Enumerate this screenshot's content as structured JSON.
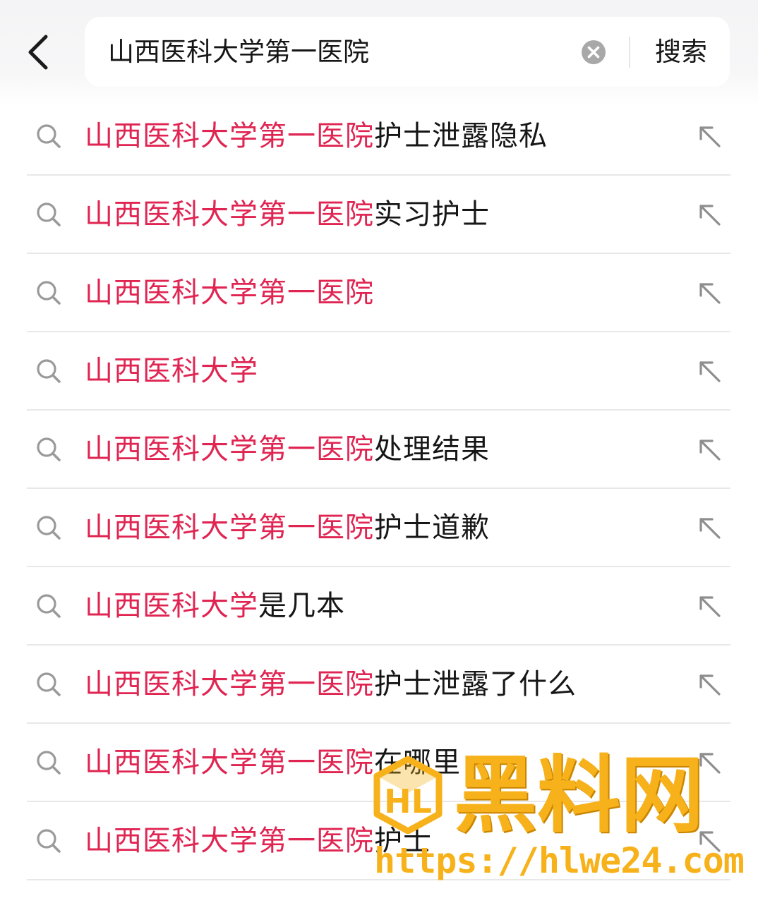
{
  "header": {
    "back_icon": "chevron-left-icon",
    "search": {
      "value": "山西医科大学第一医院",
      "clear_icon": "clear-circle-icon",
      "button_label": "搜索"
    }
  },
  "suggestions": [
    {
      "highlight": "山西医科大学第一医院",
      "rest": "护士泄露隐私"
    },
    {
      "highlight": "山西医科大学第一医院",
      "rest": "实习护士"
    },
    {
      "highlight": "山西医科大学第一医院",
      "rest": ""
    },
    {
      "highlight": "山西医科大学",
      "rest": ""
    },
    {
      "highlight": "山西医科大学第一医院",
      "rest": "处理结果"
    },
    {
      "highlight": "山西医科大学第一医院",
      "rest": "护士道歉"
    },
    {
      "highlight": "山西医科大学",
      "rest": "是几本"
    },
    {
      "highlight": "山西医科大学第一医院",
      "rest": "护士泄露了什么"
    },
    {
      "highlight": "山西医科大学第一医院",
      "rest": "在哪里"
    },
    {
      "highlight": "山西医科大学第一医院",
      "rest": "护士"
    }
  ],
  "watermark": {
    "title": "黑料网",
    "url": "https://hlwe24.com"
  },
  "colors": {
    "highlight": "#e02552",
    "text": "#161616",
    "icon": "#9a9a9a",
    "watermark": "#f7b21b"
  }
}
